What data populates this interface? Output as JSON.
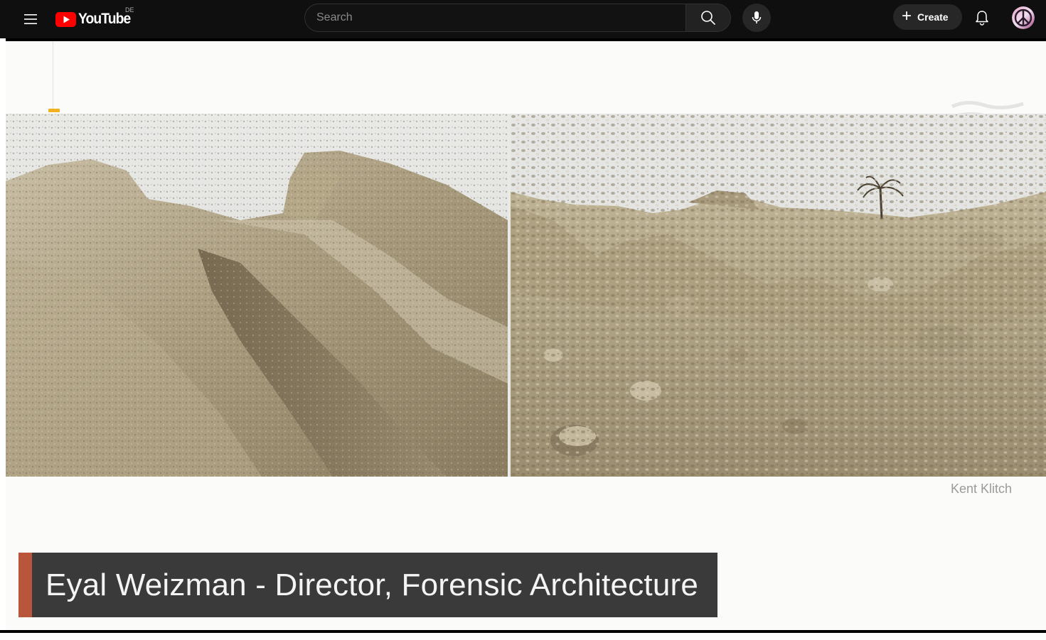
{
  "header": {
    "menu_icon": "hamburger-menu-icon",
    "logo_text": "YouTube",
    "region": "DE",
    "search_placeholder": "Search",
    "search_icon": "search-icon",
    "mic_icon": "microphone-icon",
    "create_label": "Create",
    "create_icon": "plus-icon",
    "notifications_icon": "bell-icon",
    "avatar_icon": "peace-sign-avatar"
  },
  "video": {
    "photo_credit": "Kent Klitch",
    "lower_third": "Eyal Weizman - Director, Forensic Architecture",
    "colors": {
      "lower_third_bg": "#3a3a3a",
      "lower_third_accent": "#b8553a",
      "progress_marker": "#f0b020",
      "logo_red": "#ff0000"
    }
  }
}
